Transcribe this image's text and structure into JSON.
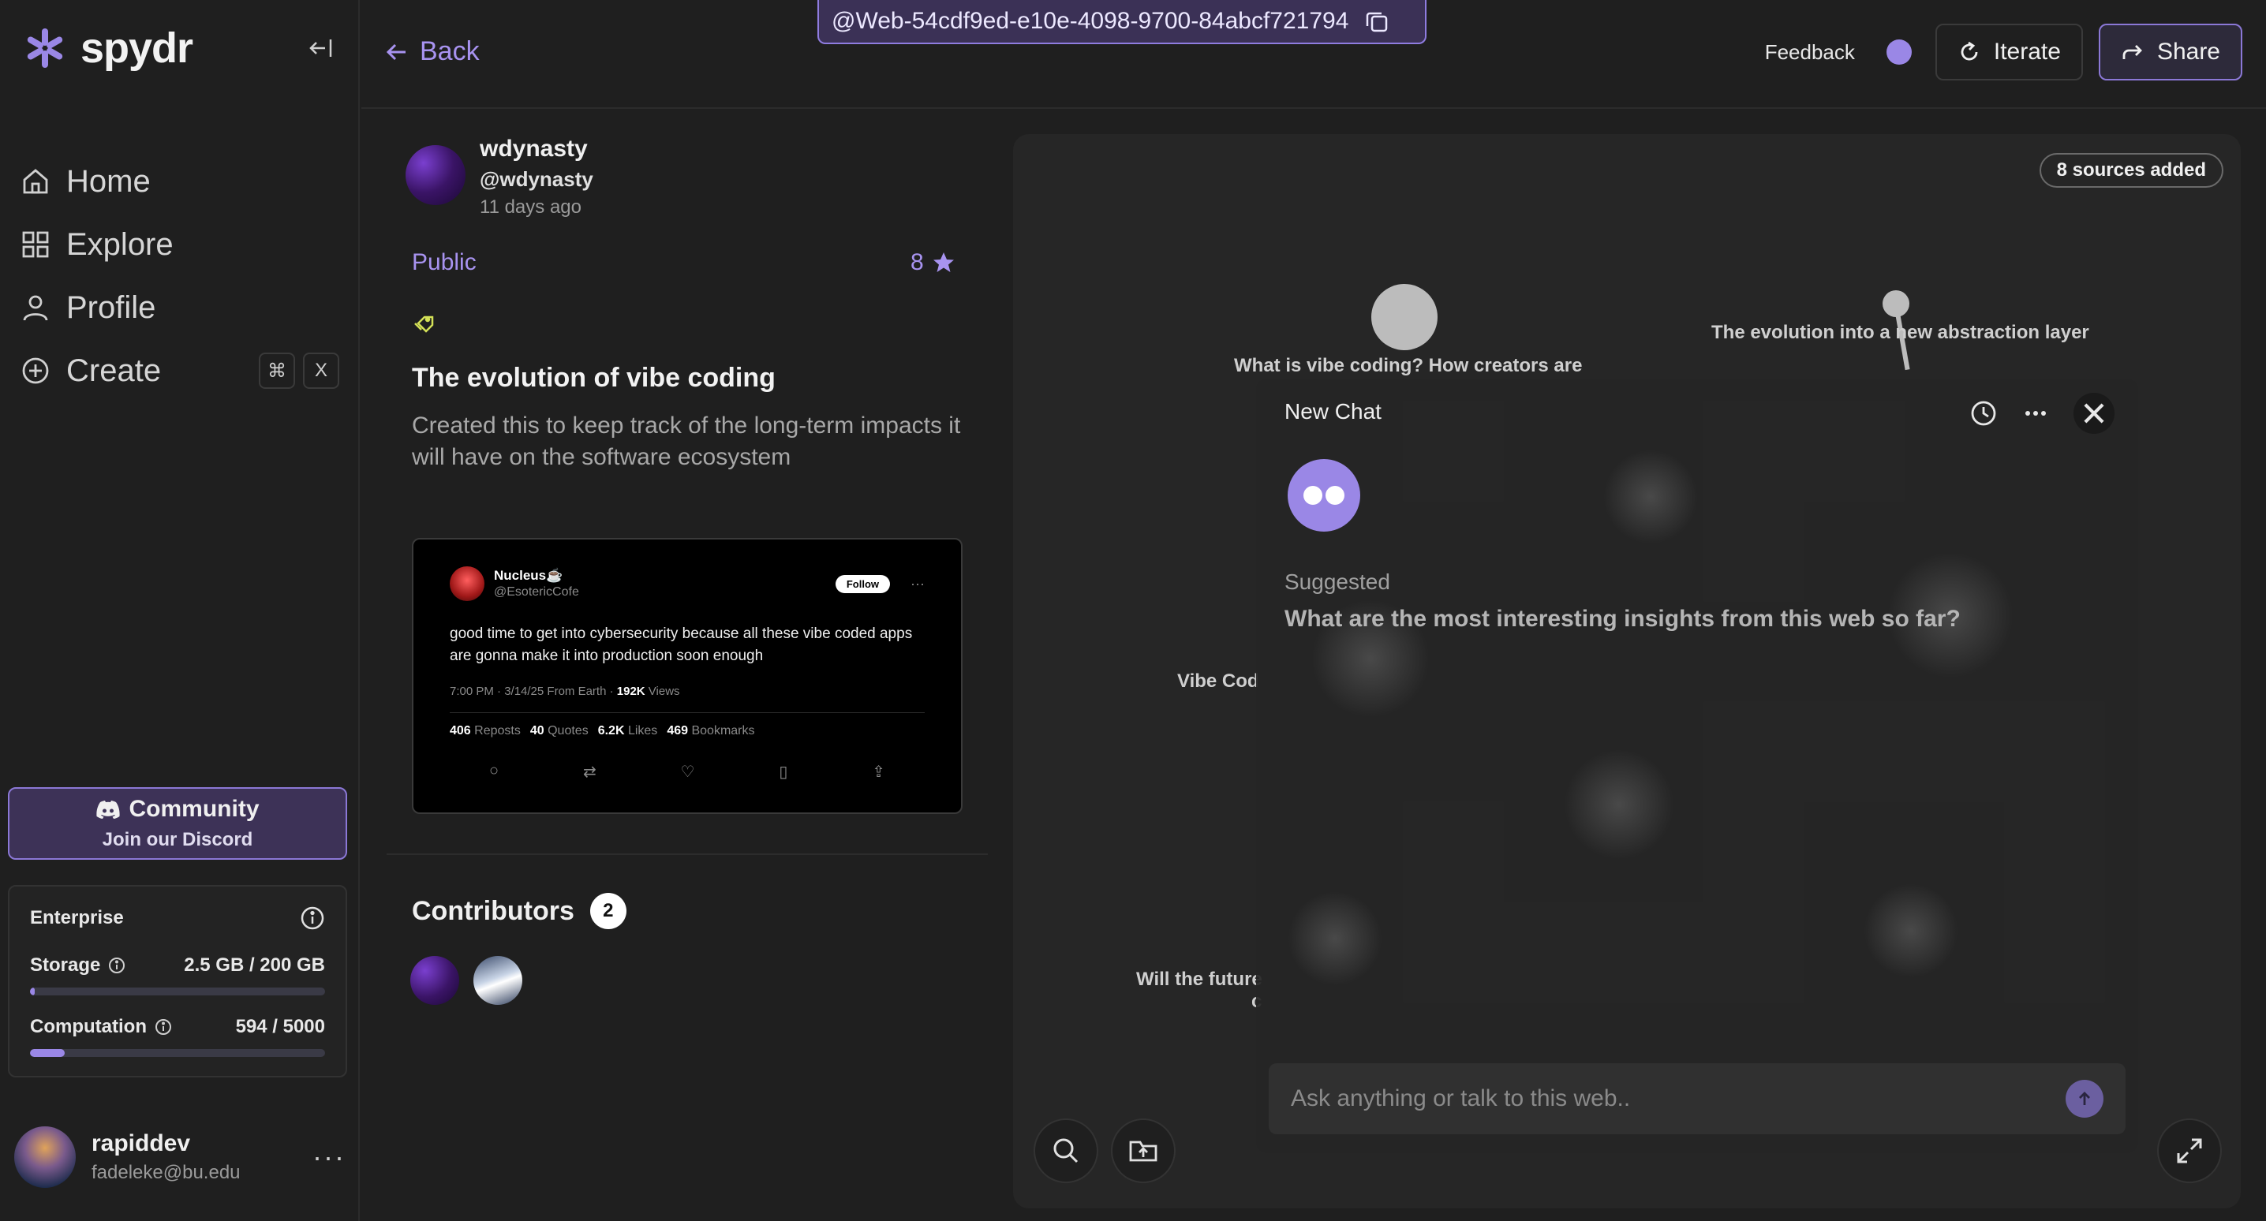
{
  "brand": {
    "name": "spydr",
    "accent": "#9a87e6"
  },
  "sidebar": {
    "items": [
      {
        "label": "Home",
        "icon": "home-icon"
      },
      {
        "label": "Explore",
        "icon": "grid-icon"
      },
      {
        "label": "Profile",
        "icon": "user-icon"
      },
      {
        "label": "Create",
        "icon": "plus-circle-icon"
      }
    ],
    "create_shortcut": [
      "⌘",
      "X"
    ],
    "community": {
      "title": "Community",
      "subtitle": "Join our Discord"
    },
    "plan": {
      "name": "Enterprise",
      "storage_label": "Storage",
      "storage_value": "2.5 GB / 200 GB",
      "storage_fraction": 0.0125,
      "computation_label": "Computation",
      "computation_value": "594 / 5000",
      "computation_fraction": 0.1188
    },
    "user": {
      "name": "rapiddev",
      "email": "fadeleke@bu.edu"
    }
  },
  "topbar": {
    "back_label": "Back",
    "web_id": "@Web-54cdf9ed-e10e-4098-9700-84abcf721794",
    "feedback_label": "Feedback",
    "iterate_label": "Iterate",
    "share_label": "Share"
  },
  "web": {
    "author_name": "wdynasty",
    "author_handle": "@wdynasty",
    "created": "11 days ago",
    "visibility": "Public",
    "stars": "8",
    "title": "The evolution of vibe coding",
    "description": "Created this to keep track of the long-term impacts it will have on the software ecosystem",
    "tweet": {
      "name": "Nucleus☕️",
      "handle": "@EsotericCofe",
      "follow_label": "Follow",
      "text": "good time to get into cybersecurity because all these vibe coded apps are gonna make it into production soon enough",
      "meta_prefix": "7:00 PM · 3/14/25 From Earth · ",
      "views": "192K",
      "views_label": "Views",
      "reposts": "406",
      "reposts_label": "Reposts",
      "quotes": "40",
      "quotes_label": "Quotes",
      "likes": "6.2K",
      "likes_label": "Likes",
      "bookmarks": "469",
      "bookmarks_label": "Bookmarks"
    },
    "contributors_label": "Contributors",
    "contributors_count": "2"
  },
  "graph": {
    "sources_badge": "8 sources added",
    "node_labels": [
      "What is vibe coding? How creators are",
      "The evolution into a new abstraction layer",
      "Vibe Cod",
      "Will the future",
      "c"
    ]
  },
  "chat": {
    "title": "New Chat",
    "suggested_label": "Suggested",
    "suggested_question": "What are the most interesting insights from this web so far?",
    "input_placeholder": "Ask anything or talk to this web.."
  }
}
